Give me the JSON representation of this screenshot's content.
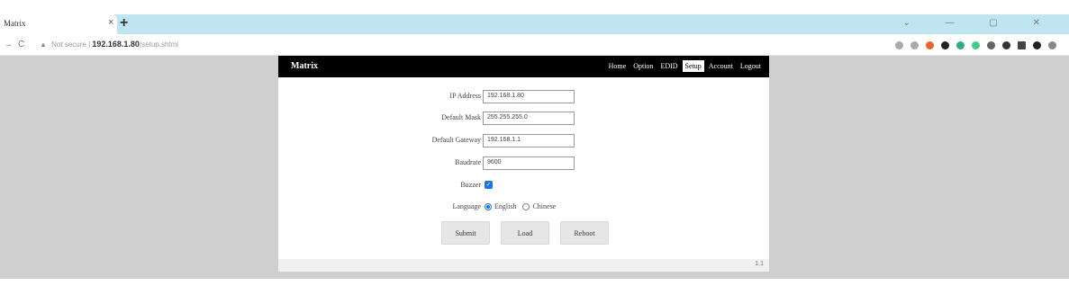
{
  "browser": {
    "tab_title": "Matrix",
    "tab_close": "×",
    "new_tab": "+",
    "window_controls": "⌄ — ▢ ✕",
    "back": "←",
    "forward": "→",
    "reload": "C",
    "url_security": "Not secure",
    "url_host": "192.168.1.80",
    "url_path": "/setup.shtml"
  },
  "app": {
    "brand": "Matrix",
    "nav": [
      "Home",
      "Option",
      "EDID",
      "Setup",
      "Account",
      "Logout"
    ],
    "active_nav": "Setup",
    "fields": {
      "ip_label": "IP Address",
      "ip_value": "192.168.1.80",
      "mask_label": "Default Mask",
      "mask_value": "255.255.255.0",
      "gateway_label": "Default Gateway",
      "gateway_value": "192.168.1.1",
      "baud_label": "Baudrate",
      "baud_value": "9600",
      "buzzer_label": "Buzzer",
      "language_label": "Language",
      "lang_english": "English",
      "lang_chinese": "Chinese"
    },
    "buttons": {
      "submit": "Submit",
      "load": "Load",
      "reboot": "Reboot"
    },
    "footer_version": "1.1"
  },
  "colors": {
    "header_bg": "#000000",
    "tabstrip_bg": "#bfe6f0",
    "page_bg": "#cfcfcf",
    "accent": "#1a73e8"
  }
}
